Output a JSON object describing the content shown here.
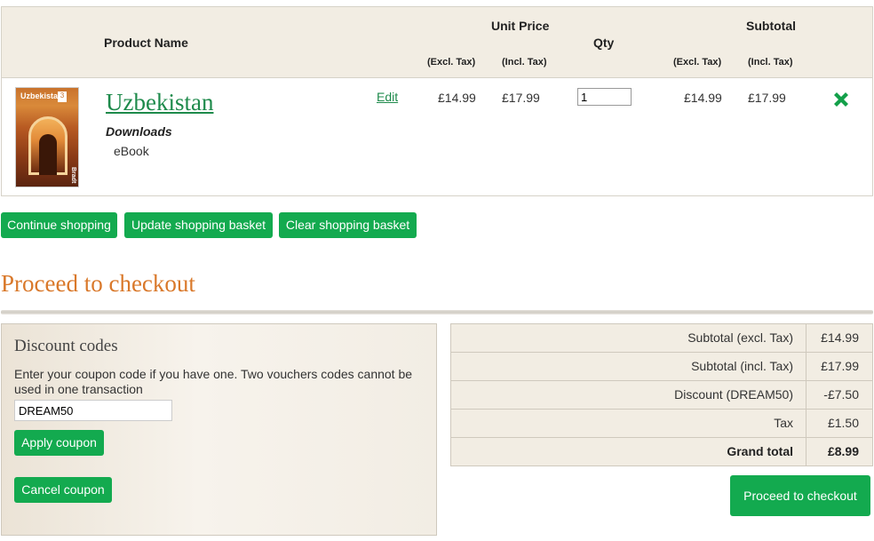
{
  "cart_table": {
    "headers": {
      "product_name": "Product Name",
      "unit_price": "Unit Price",
      "qty": "Qty",
      "subtotal": "Subtotal",
      "excl_tax": "(Excl. Tax)",
      "incl_tax": "(Incl. Tax)"
    },
    "items": [
      {
        "name": "Uzbekistan",
        "option_label": "Downloads",
        "option_value": "eBook",
        "edit_label": "Edit",
        "unit_price_excl": "£14.99",
        "unit_price_incl": "£17.99",
        "qty": "1",
        "subtotal_excl": "£14.99",
        "subtotal_incl": "£17.99",
        "cover": {
          "title": "Uzbekistan",
          "badge": "3",
          "brand": "Bradt"
        }
      }
    ]
  },
  "cart_actions": {
    "continue_label": "Continue shopping",
    "update_label": "Update shopping basket",
    "clear_label": "Clear shopping basket"
  },
  "checkout": {
    "heading": "Proceed to checkout",
    "button_label": "Proceed to checkout"
  },
  "discount": {
    "title": "Discount codes",
    "description": "Enter your coupon code if you have one. Two vouchers codes cannot be used in one transaction",
    "code_value": "DREAM50",
    "apply_label": "Apply coupon",
    "cancel_label": "Cancel coupon"
  },
  "totals": [
    {
      "label": "Subtotal (excl. Tax)",
      "value": "£14.99"
    },
    {
      "label": "Subtotal (incl. Tax)",
      "value": "£17.99"
    },
    {
      "label": "Discount (DREAM50)",
      "value": "-£7.50"
    },
    {
      "label": "Tax",
      "value": "£1.50"
    },
    {
      "label": "Grand total",
      "value": "£8.99"
    }
  ],
  "colors": {
    "accent_green": "#13aa4f",
    "link_green": "#1e8a4b",
    "heading_orange": "#d9782a",
    "table_header_bg": "#f2ede3"
  },
  "icons": {
    "remove": "close-x-icon"
  }
}
